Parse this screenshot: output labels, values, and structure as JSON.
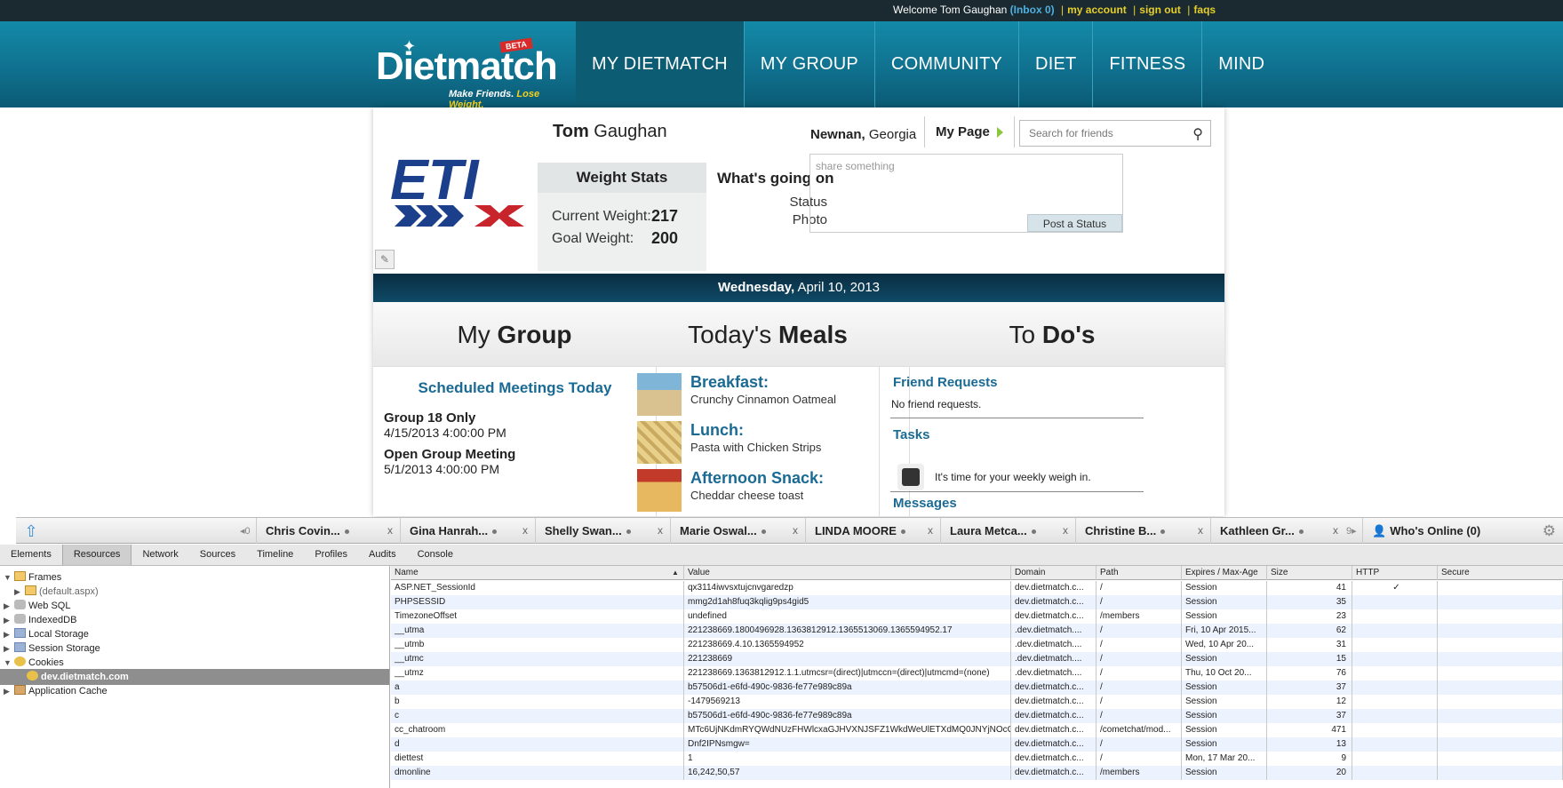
{
  "topbar": {
    "welcome": "Welcome Tom Gaughan",
    "inbox": "(Inbox 0)",
    "my_account": "my account",
    "sign_out": "sign out",
    "faqs": "faqs"
  },
  "logo": {
    "name": "Dietmatch",
    "tag_a": "Make Friends.",
    "tag_b": "Lose Weight.",
    "beta": "BETA"
  },
  "nav": [
    "MY DIETMATCH",
    "MY GROUP",
    "COMMUNITY",
    "DIET",
    "FITNESS",
    "MIND"
  ],
  "profile": {
    "first": "Tom",
    "last": "Gaughan",
    "city": "Newnan,",
    "state": "Georgia",
    "my_page": "My Page",
    "search_placeholder": "Search for friends",
    "logo_text": "ETI"
  },
  "weight": {
    "title": "Weight Stats",
    "current_label": "Current Weight:",
    "current": "217",
    "goal_label": "Goal Weight:",
    "goal": "200"
  },
  "status": {
    "title": "What's going on",
    "opt1": "Status",
    "opt2": "Photo",
    "placeholder": "share something",
    "post": "Post a Status"
  },
  "date": {
    "day": "Wednesday,",
    "rest": "April 10, 2013"
  },
  "group": {
    "h_light": "My",
    "h_bold": "Group",
    "sched": "Scheduled Meetings Today",
    "m1_name": "Group 18 Only",
    "m1_time": "4/15/2013 4:00:00 PM",
    "m2_name": "Open Group Meeting",
    "m2_time": "5/1/2013 4:00:00 PM"
  },
  "meals": {
    "h_light": "Today's",
    "h_bold": "Meals",
    "b_t": "Breakfast:",
    "b_s": "Crunchy Cinnamon Oatmeal",
    "l_t": "Lunch:",
    "l_s": "Pasta with Chicken Strips",
    "a_t": "Afternoon Snack:",
    "a_s": "Cheddar cheese toast"
  },
  "todos": {
    "h_light": "To",
    "h_bold": "Do's",
    "fr": "Friend Requests",
    "fr_none": "No friend requests.",
    "tasks": "Tasks",
    "task1": "It's time for your weekly weigh in.",
    "messages": "Messages"
  },
  "chat": {
    "prev": "◂0",
    "tabs": [
      "Chris Covin...",
      "Gina Hanrah...",
      "Shelly Swan...",
      "Marie Oswal...",
      "LINDA MOORE",
      "Laura Metca...",
      "Christine B...",
      "Kathleen Gr..."
    ],
    "next": "9▸",
    "online": "Who's Online (0)"
  },
  "devtools": {
    "tabs": [
      "Elements",
      "Resources",
      "Network",
      "Sources",
      "Timeline",
      "Profiles",
      "Audits",
      "Console"
    ],
    "tree": {
      "frames": "Frames",
      "default": "(default.aspx)",
      "websql": "Web SQL",
      "indexeddb": "IndexedDB",
      "local": "Local Storage",
      "session": "Session Storage",
      "cookies": "Cookies",
      "domain": "dev.dietmatch.com",
      "appcache": "Application Cache"
    },
    "columns": [
      "Name",
      "Value",
      "Domain",
      "Path",
      "Expires / Max-Age",
      "Size",
      "HTTP",
      "Secure"
    ],
    "rows": [
      [
        "ASP.NET_SessionId",
        "qx3114iwvsxtujcnvgaredzp",
        "dev.dietmatch.c...",
        "/",
        "Session",
        "41",
        "✓",
        ""
      ],
      [
        "PHPSESSID",
        "mmg2d1ah8fuq3kqlig9ps4gid5",
        "dev.dietmatch.c...",
        "/",
        "Session",
        "35",
        "",
        ""
      ],
      [
        "TimezoneOffset",
        "undefined",
        "dev.dietmatch.c...",
        "/members",
        "Session",
        "23",
        "",
        ""
      ],
      [
        "__utma",
        "221238669.1800496928.1363812912.1365513069.1365594952.17",
        ".dev.dietmatch....",
        "/",
        "Fri, 10 Apr 2015...",
        "62",
        "",
        ""
      ],
      [
        "__utmb",
        "221238669.4.10.1365594952",
        ".dev.dietmatch....",
        "/",
        "Wed, 10 Apr 20...",
        "31",
        "",
        ""
      ],
      [
        "__utmc",
        "221238669",
        ".dev.dietmatch....",
        "/",
        "Session",
        "15",
        "",
        ""
      ],
      [
        "__utmz",
        "221238669.1363812912.1.1.utmcsr=(direct)|utmccn=(direct)|utmcmd=(none)",
        ".dev.dietmatch....",
        "/",
        "Thu, 10 Oct 20...",
        "76",
        "",
        ""
      ],
      [
        "a",
        "b57506d1-e6fd-490c-9836-fe77e989c89a",
        "dev.dietmatch.c...",
        "/",
        "Session",
        "37",
        "",
        ""
      ],
      [
        "b",
        "-1479569213",
        "dev.dietmatch.c...",
        "/",
        "Session",
        "12",
        "",
        ""
      ],
      [
        "c",
        "b57506d1-e6fd-490c-9836-fe77e989c89a",
        "dev.dietmatch.c...",
        "/",
        "Session",
        "37",
        "",
        ""
      ],
      [
        "cc_chatroom",
        "MTc6UjNKdmRYQWdNUzFHWlcxaGJHVXNJSFZ1WkdWeUlETXdMQ0JNYjNOcGJtY2diR1Z6Y...",
        "dev.dietmatch.c...",
        "/cometchat/mod...",
        "Session",
        "471",
        "",
        ""
      ],
      [
        "d",
        "Dnf2IPNsmgw=",
        "dev.dietmatch.c...",
        "/",
        "Session",
        "13",
        "",
        ""
      ],
      [
        "diettest",
        "1",
        "dev.dietmatch.c...",
        "/",
        "Mon, 17 Mar 20...",
        "9",
        "",
        ""
      ],
      [
        "dmonline",
        "16,242,50,57",
        "dev.dietmatch.c...",
        "/members",
        "Session",
        "20",
        "",
        ""
      ]
    ]
  }
}
